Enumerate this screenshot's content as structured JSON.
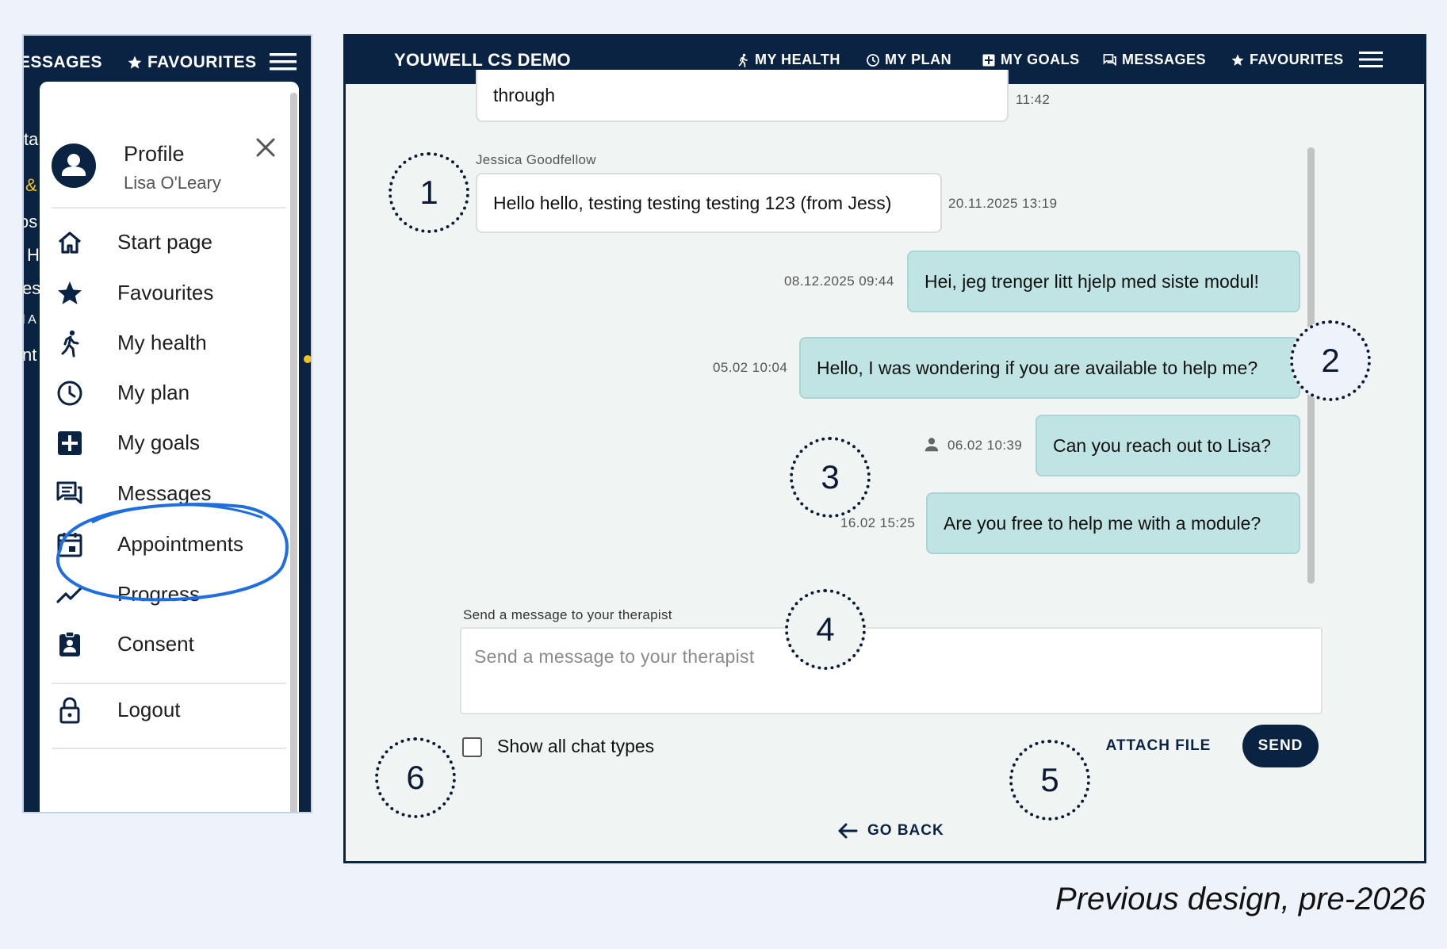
{
  "left": {
    "topbar": {
      "messages_fragment": "ESSAGES",
      "favourites": "FAVOURITES"
    },
    "background_fragments": [
      "ta",
      "&",
      "os",
      "H",
      "es",
      "l A",
      "nt"
    ],
    "profile": {
      "title": "Profile",
      "name": "Lisa O'Leary"
    },
    "menu": [
      {
        "label": "Start page",
        "icon": "home-icon"
      },
      {
        "label": "Favourites",
        "icon": "star-icon"
      },
      {
        "label": "My health",
        "icon": "walking-icon"
      },
      {
        "label": "My plan",
        "icon": "clock-icon"
      },
      {
        "label": "My goals",
        "icon": "goals-icon"
      },
      {
        "label": "Messages",
        "icon": "chat-icon"
      },
      {
        "label": "Appointments",
        "icon": "calendar-icon"
      },
      {
        "label": "Progress",
        "icon": "trend-icon"
      },
      {
        "label": "Consent",
        "icon": "badge-icon"
      },
      {
        "label": "Logout",
        "icon": "lock-icon"
      }
    ]
  },
  "right": {
    "app_title": "YOUWELL CS DEMO",
    "nav": [
      {
        "label": "MY HEALTH",
        "icon": "walking-icon"
      },
      {
        "label": "MY PLAN",
        "icon": "clock-icon"
      },
      {
        "label": "MY GOALS",
        "icon": "goals-icon"
      },
      {
        "label": "MESSAGES",
        "icon": "chat-icon"
      },
      {
        "label": "FAVOURITES",
        "icon": "star-icon"
      }
    ],
    "messages": [
      {
        "text": "through",
        "time": "11:42"
      },
      {
        "sender": "Jessica Goodfellow",
        "text": "Hello hello, testing testing testing 123 (from Jess)",
        "time": "20.11.2025 13:19"
      },
      {
        "text": "Hei, jeg trenger litt hjelp med siste modul!",
        "time": "08.12.2025 09:44"
      },
      {
        "text": "Hello, I was wondering if you are available to help me?",
        "time": "05.02 10:04"
      },
      {
        "text": "Can you reach out to Lisa?",
        "time": "06.02 10:39"
      },
      {
        "text": "Are you free to help me with a module?",
        "time": "16.02 15:25"
      }
    ],
    "compose": {
      "label": "Send a message to your therapist",
      "placeholder": "Send a message to your therapist"
    },
    "show_all_label": "Show all chat types",
    "attach_label": "ATTACH FILE",
    "send_label": "SEND",
    "go_back_label": "GO BACK"
  },
  "annotations": [
    "1",
    "2",
    "3",
    "4",
    "5",
    "6"
  ],
  "caption": "Previous design, pre-2026",
  "colors": {
    "navy": "#0b2343",
    "bubble_out": "#bfe4e3",
    "panel_bg": "#f0f5f4",
    "page_bg": "#eef3fb",
    "highlight_ring": "#1f6ee0"
  }
}
